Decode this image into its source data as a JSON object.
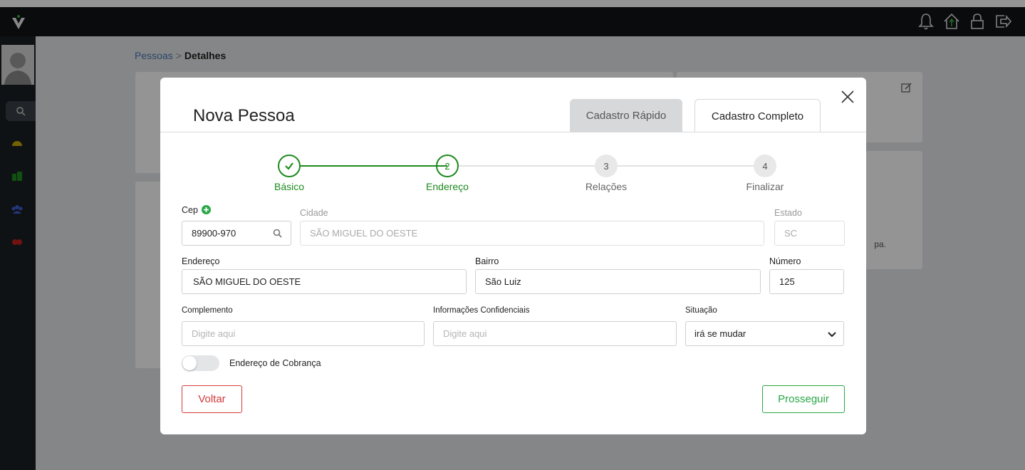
{
  "topbar": {
    "icons": [
      "bell-icon",
      "home-icon",
      "lock-icon",
      "logout-icon"
    ]
  },
  "sidebar": {
    "items": [
      "search-icon",
      "dashboard-icon",
      "buildings-icon",
      "people-icon",
      "settings-icon"
    ]
  },
  "background": {
    "breadcrumb_link": "Pessoas",
    "breadcrumb_sep": ">",
    "breadcrumb_current": "Detalhes",
    "card_fragment": "pa."
  },
  "modal": {
    "title": "Nova Pessoa",
    "tabs": {
      "quick": "Cadastro Rápido",
      "full": "Cadastro Completo"
    },
    "steps": [
      {
        "number": "✓",
        "label": "Básico",
        "state": "done"
      },
      {
        "number": "2",
        "label": "Endereço",
        "state": "active"
      },
      {
        "number": "3",
        "label": "Relações",
        "state": "pending"
      },
      {
        "number": "4",
        "label": "Finalizar",
        "state": "pending"
      }
    ],
    "form": {
      "cep_label": "Cep",
      "cep_value": "89900-970",
      "cidade_label": "Cidade",
      "cidade_value": "SÃO MIGUEL DO OESTE",
      "estado_label": "Estado",
      "estado_value": "SC",
      "endereco_label": "Endereço",
      "endereco_value": "SÃO MIGUEL DO OESTE",
      "bairro_label": "Bairro",
      "bairro_value": "São Luiz",
      "numero_label": "Número",
      "numero_value": "125",
      "complemento_label": "Complemento",
      "complemento_placeholder": "Digite aqui",
      "info_label": "Informações Confidenciais",
      "info_placeholder": "Digite aqui",
      "situacao_label": "Situação",
      "situacao_value": "irá se mudar",
      "cobranca_label": "Endereço de Cobrança"
    },
    "buttons": {
      "back": "Voltar",
      "next": "Prosseguir"
    }
  },
  "colors": {
    "green": "#1e8a1e",
    "accent_green": "#28a745",
    "red": "#d23a3a",
    "topbar": "#111417"
  }
}
